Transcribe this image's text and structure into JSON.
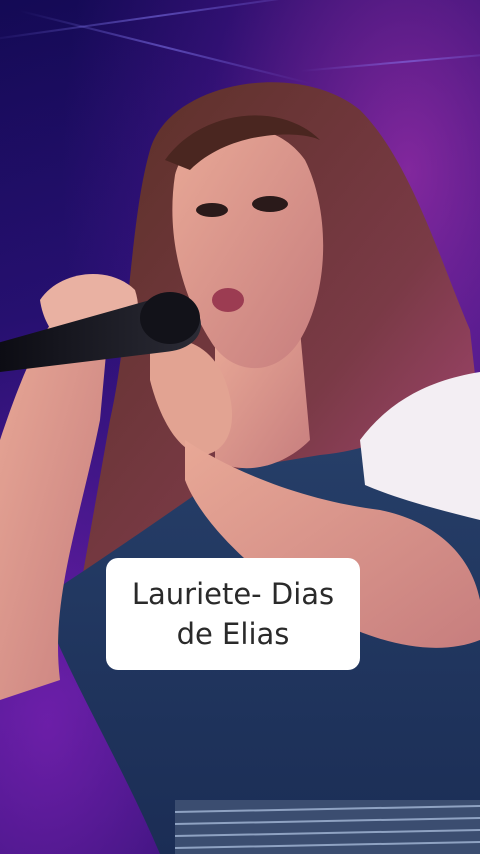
{
  "video": {
    "caption": {
      "line1": "Lauriete- Dias",
      "line2": "de Elias"
    }
  },
  "colors": {
    "background_dark": "#1a0b4a",
    "stage_glow_pink": "#d23cc8",
    "caption_bg": "#ffffff",
    "caption_text": "#2a2a2a"
  }
}
